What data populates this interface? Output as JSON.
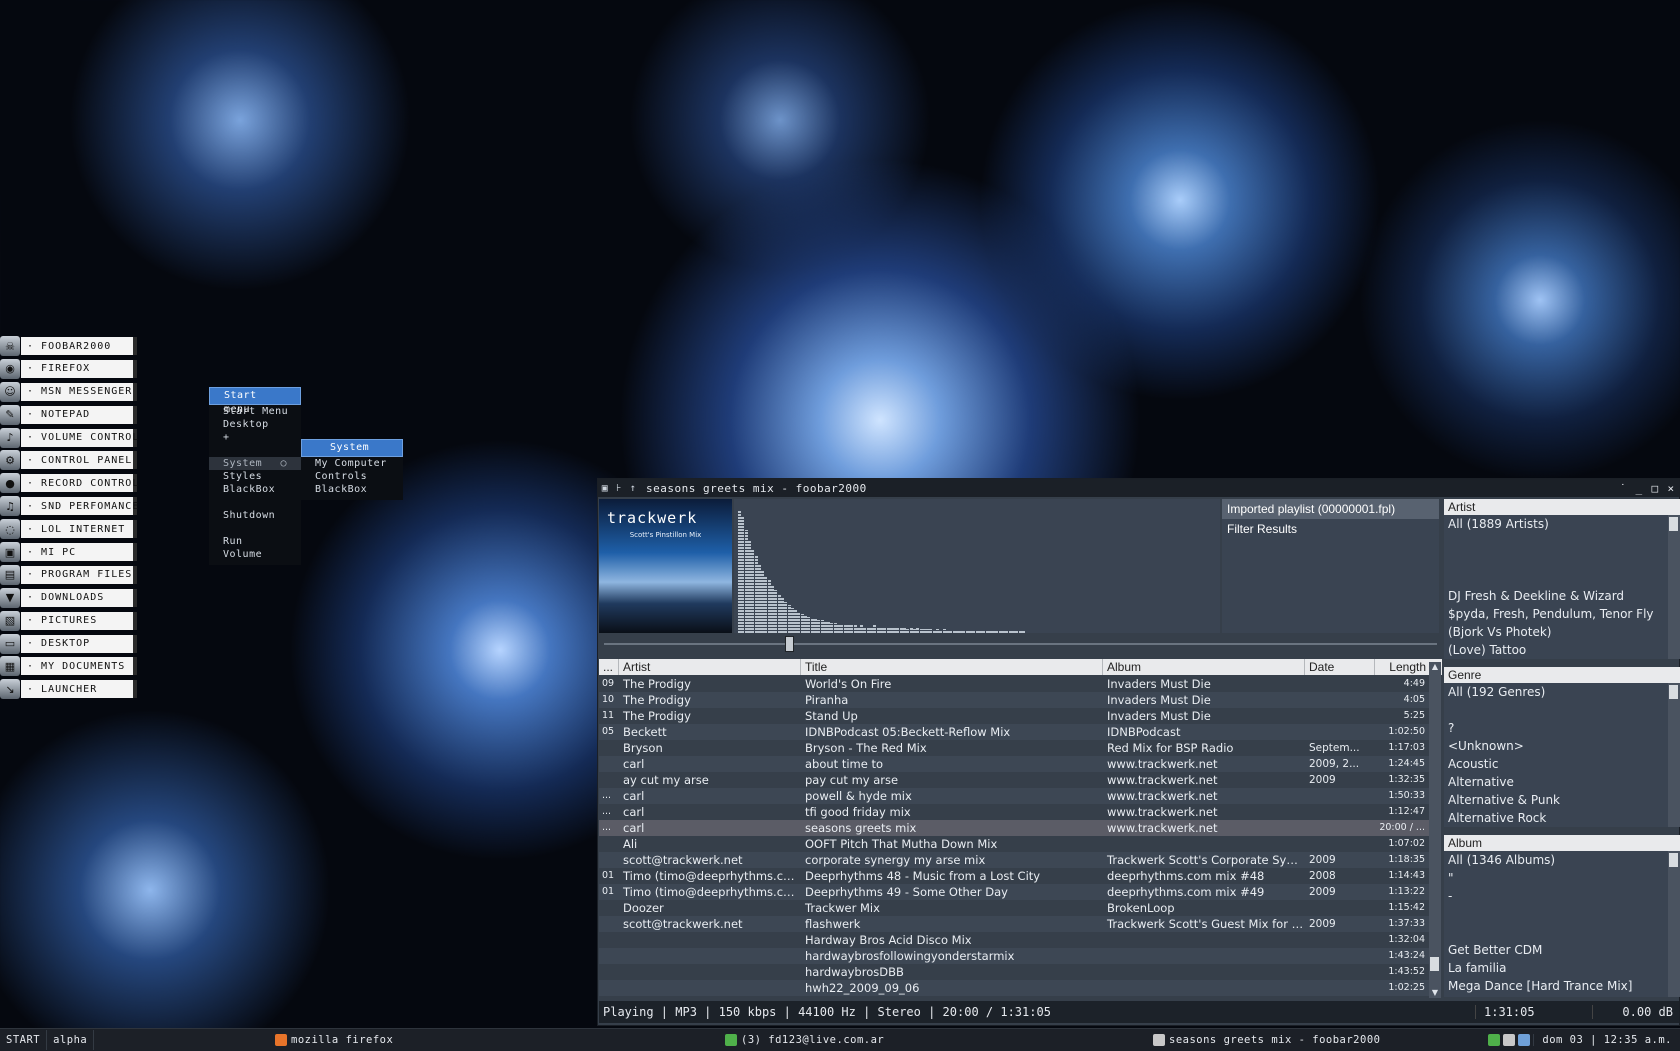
{
  "launcher": {
    "items": [
      {
        "label": "FOOBAR2000",
        "icon": "skull-icon",
        "glyph": "☠"
      },
      {
        "label": "FIREFOX",
        "icon": "firefox-icon",
        "glyph": "◉"
      },
      {
        "label": "MSN MESSENGER",
        "icon": "msn-icon",
        "glyph": "☺"
      },
      {
        "label": "NOTEPAD",
        "icon": "notepad-icon",
        "glyph": "✎"
      },
      {
        "label": "VOLUME CONTROL",
        "icon": "speaker-icon",
        "glyph": "♪"
      },
      {
        "label": "CONTROL PANEL",
        "icon": "control-panel-icon",
        "glyph": "⚙"
      },
      {
        "label": "RECORD CONTROL",
        "icon": "record-icon",
        "glyph": "●"
      },
      {
        "label": "SND PERFOMANCE",
        "icon": "sound-icon",
        "glyph": "♫"
      },
      {
        "label": "LOL INTERNET",
        "icon": "globe-icon",
        "glyph": "◌"
      },
      {
        "label": "MI PC",
        "icon": "computer-icon",
        "glyph": "▣"
      },
      {
        "label": "PROGRAM FILES",
        "icon": "folder-icon",
        "glyph": "▤"
      },
      {
        "label": "DOWNLOADS",
        "icon": "download-icon",
        "glyph": "▼"
      },
      {
        "label": "PICTURES",
        "icon": "pictures-icon",
        "glyph": "▧"
      },
      {
        "label": "DESKTOP",
        "icon": "desktop-icon",
        "glyph": "▭"
      },
      {
        "label": "MY DOCUMENTS",
        "icon": "documents-icon",
        "glyph": "▦"
      },
      {
        "label": "LAUNCHER",
        "icon": "launcher-arrow-icon",
        "glyph": "↘"
      }
    ],
    "prefix": "· "
  },
  "start_menu": {
    "title": "Start menu",
    "items": [
      "Start Menu",
      "Desktop",
      "+"
    ],
    "system": "System",
    "items2": [
      "Styles",
      "BlackBox"
    ],
    "shutdown": "Shutdown",
    "items3": [
      "Run",
      "Volume"
    ]
  },
  "system_menu": {
    "title": "System",
    "items": [
      "My Computer",
      "Controls",
      "BlackBox"
    ]
  },
  "foobar": {
    "title": "seasons greets mix - foobar2000",
    "title_buttons": [
      "▣",
      "⊦",
      "↑"
    ],
    "window_buttons": [
      "˙",
      "_",
      "□",
      "×"
    ],
    "album_art": {
      "logo": "trackwerk",
      "subtitle": "Scott's Pinstillon Mix"
    },
    "playlists": [
      {
        "name": "Imported playlist (00000001.fpl)",
        "active": true
      },
      {
        "name": "Filter Results",
        "active": false
      }
    ],
    "columns": [
      "...",
      "Artist",
      "Title",
      "Album",
      "Date",
      "Length"
    ],
    "rows": [
      {
        "n": "09",
        "artist": "The Prodigy",
        "title": "World's On Fire",
        "album": "Invaders Must Die",
        "date": "",
        "length": "4:49"
      },
      {
        "n": "10",
        "artist": "The Prodigy",
        "title": "Piranha",
        "album": "Invaders Must Die",
        "date": "",
        "length": "4:05"
      },
      {
        "n": "11",
        "artist": "The Prodigy",
        "title": "Stand Up",
        "album": "Invaders Must Die",
        "date": "",
        "length": "5:25"
      },
      {
        "n": "05",
        "artist": "Beckett",
        "title": "IDNBPodcast 05:Beckett-Reflow Mix",
        "album": "IDNBPodcast",
        "date": "",
        "length": "1:02:50"
      },
      {
        "n": "",
        "artist": "Bryson",
        "title": "Bryson - The Red Mix",
        "album": "Red Mix for BSP Radio",
        "date": "Septem...",
        "length": "1:17:03"
      },
      {
        "n": "",
        "artist": "carl",
        "title": "about time to",
        "album": "www.trackwerk.net",
        "date": "2009, 2...",
        "length": "1:24:45"
      },
      {
        "n": "",
        "artist": "ay cut my arse",
        "title": "pay cut my arse",
        "album": "www.trackwerk.net",
        "date": "2009",
        "length": "1:32:35"
      },
      {
        "n": "...",
        "artist": "carl",
        "title": "powell & hyde mix",
        "album": "www.trackwerk.net",
        "date": "",
        "length": "1:50:33"
      },
      {
        "n": "...",
        "artist": "carl",
        "title": "tfi good friday mix",
        "album": "www.trackwerk.net",
        "date": "",
        "length": "1:12:47"
      },
      {
        "n": "...",
        "artist": "carl",
        "title": "seasons greets mix",
        "album": "www.trackwerk.net",
        "date": "",
        "length": "20:00 / ...",
        "playing": true
      },
      {
        "n": "",
        "artist": "Ali",
        "title": "OOFT Pitch That Mutha Down Mix",
        "album": "",
        "date": "",
        "length": "1:07:02"
      },
      {
        "n": "",
        "artist": "scott@trackwerk.net",
        "title": "corporate synergy my arse mix",
        "album": "Trackwerk Scott's Corporate Synerg...",
        "date": "2009",
        "length": "1:18:35"
      },
      {
        "n": "01",
        "artist": "Timo (timo@deeprhythms.com)",
        "title": "Deeprhythms 48 - Music from a Lost City",
        "album": "deeprhythms.com mix #48",
        "date": "2008",
        "length": "1:14:43"
      },
      {
        "n": "01",
        "artist": "Timo (timo@deeprhythms.com)",
        "title": "Deeprhythms 49 - Some Other Day",
        "album": "deeprhythms.com mix #49",
        "date": "2009",
        "length": "1:13:22"
      },
      {
        "n": "",
        "artist": "Doozer",
        "title": "Trackwer Mix",
        "album": "BrokenLoop",
        "date": "",
        "length": "1:15:42"
      },
      {
        "n": "",
        "artist": "scott@trackwerk.net",
        "title": "flashwerk",
        "album": "Trackwerk Scott's Guest Mix for Kuri...",
        "date": "2009",
        "length": "1:37:33"
      },
      {
        "n": "",
        "artist": "",
        "title": "Hardway Bros Acid Disco Mix",
        "album": "",
        "date": "",
        "length": "1:32:04"
      },
      {
        "n": "",
        "artist": "",
        "title": "hardwaybrosfollowingyonderstarmix",
        "album": "",
        "date": "",
        "length": "1:43:24"
      },
      {
        "n": "",
        "artist": "",
        "title": "hardwaybrosDBB",
        "album": "",
        "date": "",
        "length": "1:43:52"
      },
      {
        "n": "",
        "artist": "",
        "title": "hwh22_2009_09_06",
        "album": "",
        "date": "",
        "length": "1:02:25"
      }
    ],
    "filters": {
      "artist": {
        "header": "Artist",
        "items": [
          "All (1889 Artists)",
          "",
          "",
          "",
          "DJ Fresh & Deekline & Wizard",
          "$pyda, Fresh, Pendulum, Tenor Fly",
          "(Bjork Vs Photek)",
          "(Love) Tattoo"
        ]
      },
      "genre": {
        "header": "Genre",
        "items": [
          "All (192 Genres)",
          "",
          "?",
          "<Unknown>",
          "Acoustic",
          "Alternative",
          "Alternative & Punk",
          "Alternative Rock"
        ]
      },
      "album": {
        "header": "Album",
        "items": [
          "All (1346 Albums)",
          "\"",
          "-",
          "",
          "",
          "Get Better CDM",
          "La familia",
          "Mega Dance [Hard Trance Mix]"
        ]
      }
    },
    "status": {
      "main": "Playing | MP3 | 150 kbps | 44100 Hz | Stereo | 20:00 / 1:31:05",
      "total": "1:31:05",
      "volume": "0.00 dB"
    }
  },
  "taskbar": {
    "start": "START",
    "workspace": "alpha",
    "tasks": [
      {
        "label": "mozilla firefox",
        "icon": "firefox-icon",
        "color": "#e8742a"
      },
      {
        "label": "(3) fd123@live.com.ar",
        "icon": "msn-icon",
        "color": "#4fb04a"
      },
      {
        "label": "seasons greets mix - foobar2000",
        "icon": "skull-icon",
        "color": "#c8c8c8"
      }
    ],
    "clock": "dom 03 | 12:35 a.m."
  },
  "visualizer": {
    "levels": [
      0.98,
      0.93,
      0.82,
      0.74,
      0.66,
      0.62,
      0.55,
      0.5,
      0.45,
      0.42,
      0.38,
      0.34,
      0.3,
      0.28,
      0.25,
      0.22,
      0.2,
      0.18,
      0.17,
      0.15,
      0.14,
      0.13,
      0.12,
      0.11,
      0.1,
      0.1,
      0.09,
      0.09,
      0.08,
      0.08,
      0.07,
      0.07,
      0.07,
      0.06,
      0.06,
      0.06,
      0.05,
      0.06,
      0.05,
      0.05,
      0.05,
      0.06,
      0.05,
      0.04,
      0.05,
      0.04,
      0.04,
      0.05,
      0.04,
      0.04,
      0.04,
      0.03,
      0.04,
      0.03,
      0.04,
      0.03,
      0.03,
      0.03,
      0.03,
      0.02,
      0.03,
      0.02,
      0.03,
      0.02,
      0.02,
      0.02,
      0.02,
      0.02,
      0.02,
      0.02,
      0.02,
      0.01,
      0.02,
      0.01,
      0.02,
      0.01,
      0.01,
      0.01,
      0.01,
      0.01,
      0.01,
      0.01,
      0.01,
      0.01,
      0.01,
      0.01,
      0.01
    ]
  }
}
